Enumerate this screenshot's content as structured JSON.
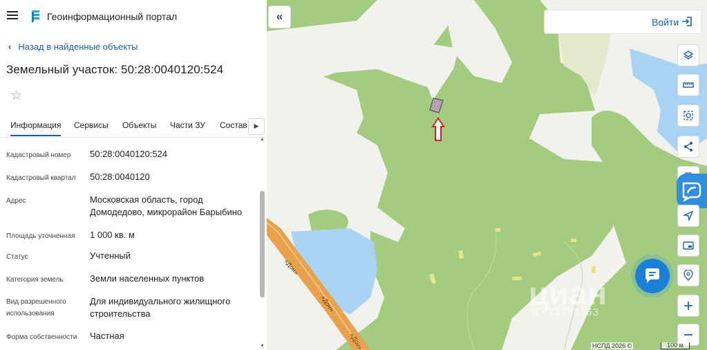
{
  "header": {
    "app_title": "Геоинформационный портал"
  },
  "nav": {
    "back_label": "Назад в найденные объекты"
  },
  "parcel": {
    "title": "Земельный участок: 50:28:0040120:524"
  },
  "tabs": [
    {
      "label": "Информация",
      "active": true
    },
    {
      "label": "Сервисы",
      "active": false
    },
    {
      "label": "Объекты",
      "active": false
    },
    {
      "label": "Части ЗУ",
      "active": false
    },
    {
      "label": "Состав",
      "active": false
    }
  ],
  "info_rows": [
    {
      "label": "Кадастровый номер",
      "value": "50:28:0040120:524"
    },
    {
      "label": "Кадастровый квартал",
      "value": "50:28:0040120"
    },
    {
      "label": "Адрес",
      "value": "Московская область, город Домодедово, микрорайон Барыбино"
    },
    {
      "label": "Площадь уточненная",
      "value": "1 000 кв. м"
    },
    {
      "label": "Статус",
      "value": "Учтенный"
    },
    {
      "label": "Категория земель",
      "value": "Земли населенных пунктов"
    },
    {
      "label": "Вид разрешенного использования",
      "value": "Для индивидуального жилищного строительства"
    },
    {
      "label": "Форма собственности",
      "value": "Частная"
    }
  ],
  "map": {
    "login_label": "Войти",
    "road_label": "«Дон»",
    "watermark": "циан",
    "watermark_id": "ID 32783563",
    "attribution": "НСПД 2026 ©",
    "scale_label": "100 м",
    "tools": [
      "layers-icon",
      "ruler-icon",
      "area-select-icon",
      "share-icon",
      "print-icon",
      "send-location-icon",
      "frame-icon",
      "location-search-icon",
      "zoom-in-icon",
      "zoom-out-icon"
    ]
  },
  "colors": {
    "accent": "#1a5fb4",
    "forest": "#a3cc7f",
    "water": "#a9d3f3",
    "road": "#e8a24b",
    "marker": "#d62222"
  }
}
